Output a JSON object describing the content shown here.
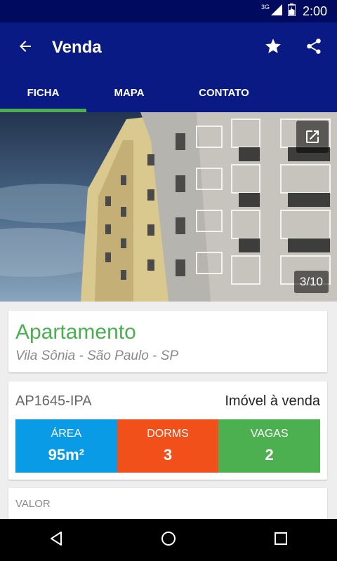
{
  "status_bar": {
    "network": "3G",
    "time": "2:00"
  },
  "app_bar": {
    "title": "Venda"
  },
  "tabs": [
    {
      "label": "FICHA",
      "active": true
    },
    {
      "label": "MAPA",
      "active": false
    },
    {
      "label": "CONTATO",
      "active": false
    }
  ],
  "photo": {
    "counter": "3/10"
  },
  "property": {
    "type": "Apartamento",
    "location": "Vila Sônia - São Paulo - SP",
    "code": "AP1645-IPA",
    "status": "Imóvel à venda"
  },
  "stats": [
    {
      "label": "ÁREA",
      "value": "95m²",
      "color": "#0a9be6"
    },
    {
      "label": "DORMS",
      "value": "3",
      "color": "#f2501b"
    },
    {
      "label": "VAGAS",
      "value": "2",
      "color": "#4caf50"
    }
  ],
  "price": {
    "label": "VALOR"
  },
  "colors": {
    "primary": "#0a1a84",
    "status_bar": "#000a5e",
    "accent": "#4caf50"
  }
}
